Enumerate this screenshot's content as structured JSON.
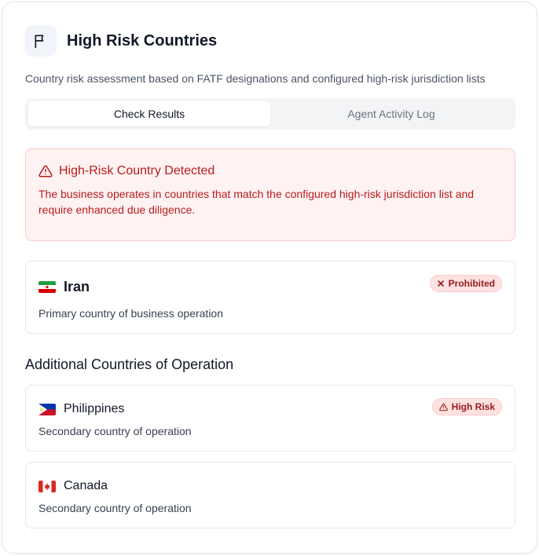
{
  "header": {
    "title": "High Risk Countries",
    "icon": "flag-icon",
    "subtitle": "Country risk assessment based on FATF designations and configured high-risk jurisdiction lists"
  },
  "tabs": [
    {
      "label": "Check Results",
      "active": true
    },
    {
      "label": "Agent Activity Log",
      "active": false
    }
  ],
  "alert": {
    "icon": "warning-triangle-icon",
    "title": "High-Risk Country Detected",
    "text": "The business operates in countries that match the configured high-risk jurisdiction list and require enhanced due diligence."
  },
  "primary_country": {
    "flag": "iran-flag",
    "name": "Iran",
    "description": "Primary country of business operation",
    "badge": {
      "icon": "x-icon",
      "label": "Prohibited"
    }
  },
  "additional_section": {
    "title": "Additional Countries of Operation",
    "countries": [
      {
        "flag": "philippines-flag",
        "name": "Philippines",
        "description": "Secondary country of operation",
        "badge": {
          "icon": "warning-triangle-icon",
          "label": "High Risk"
        }
      },
      {
        "flag": "canada-flag",
        "name": "Canada",
        "description": "Secondary country of operation"
      }
    ]
  },
  "colors": {
    "danger_text": "#b91c1c",
    "danger_bg": "#fef2f2",
    "danger_border": "#fecaca",
    "badge_text": "#991b1b"
  }
}
